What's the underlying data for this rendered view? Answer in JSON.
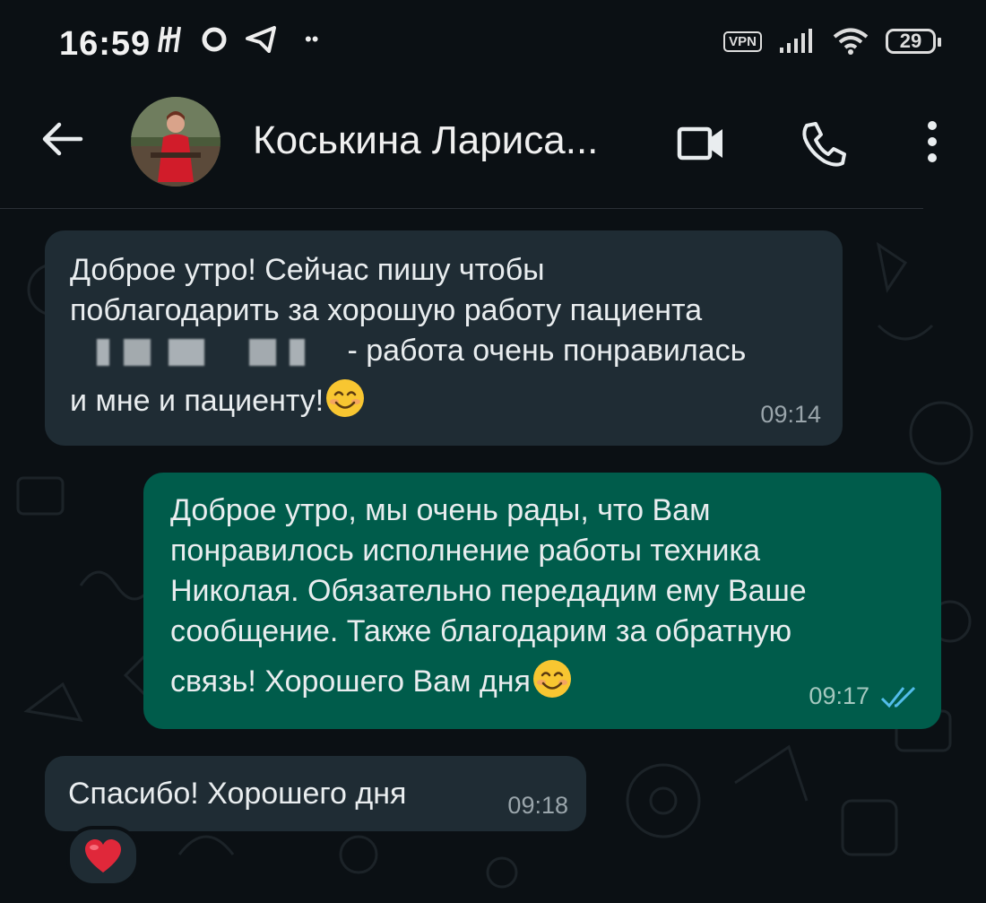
{
  "status_bar": {
    "time": "16:59",
    "left_icons": [
      "h-icon",
      "chat-bubble-icon",
      "telegram-icon"
    ],
    "more_dots": "••",
    "vpn_label": "VPN",
    "signal": "signal-bars-icon",
    "wifi": "wifi-icon",
    "battery": "29"
  },
  "header": {
    "contact_name": "Коськина Лариса...",
    "video_icon": "video-call-icon",
    "call_icon": "phone-icon",
    "menu_icon": "more-vertical-icon"
  },
  "messages": [
    {
      "direction": "incoming",
      "line1": "Доброе утро! Сейчас пишу чтобы",
      "line2": "поблагодарить за хорошую работу пациента",
      "line3_after_blur": "- работа очень понравилась",
      "line4": "и мне и пациенту!",
      "emoji": "smiling-face-emoji",
      "time": "09:14"
    },
    {
      "direction": "outgoing",
      "line1": "Доброе утро, мы очень рады, что Вам",
      "line2": "понравилось исполнение работы техника",
      "line3": "Николая. Обязательно передадим ему Ваше",
      "line4": "сообщение. Также благодарим за обратную",
      "line5": "связь! Хорошего Вам дня",
      "emoji": "smiling-face-emoji",
      "time": "09:17",
      "status": "read"
    },
    {
      "direction": "incoming",
      "text": "Спасибо! Хорошего дня",
      "time": "09:18",
      "reaction": "red-heart-emoji"
    }
  ],
  "colors": {
    "background": "#0b1014",
    "incoming_bubble": "#1f2c34",
    "outgoing_bubble": "#005c4b",
    "read_ticks": "#53bdeb"
  }
}
